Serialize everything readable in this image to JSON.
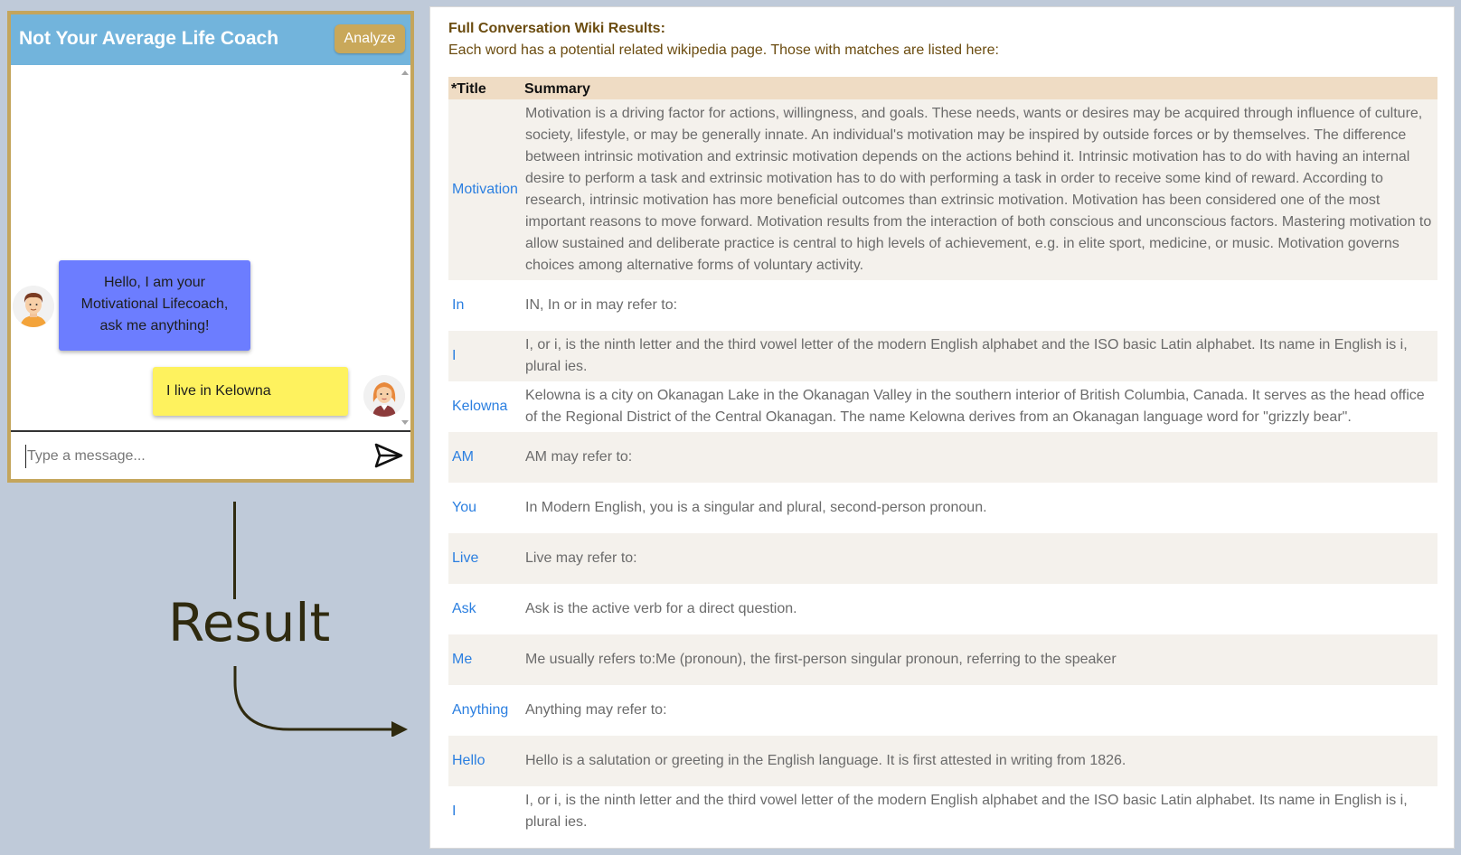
{
  "chat": {
    "title": "Not Your Average Life Coach",
    "analyze_label": "Analyze",
    "messages": [
      {
        "from": "bot",
        "text": "Hello, I am your Motivational Lifecoach, ask me anything!"
      },
      {
        "from": "user",
        "text": "I live in Kelowna"
      }
    ],
    "input_placeholder": "Type a message...",
    "input_value": ""
  },
  "annotation": {
    "label": "Result"
  },
  "wiki": {
    "heading": "Full Conversation Wiki Results:",
    "subheading": "Each word has a potential related wikipedia page. Those with matches are listed here:",
    "columns": {
      "title": "*Title",
      "summary": "Summary"
    },
    "rows": [
      {
        "title": "Motivation",
        "summary": "Motivation is a driving factor for actions, willingness, and goals. These needs, wants or desires may be acquired through influence of culture, society, lifestyle, or may be generally innate. An individual's motivation may be inspired by outside forces or by themselves. The difference between intrinsic motivation and extrinsic motivation depends on the actions behind it. Intrinsic motivation has to do with having an internal desire to perform a task and extrinsic motivation has to do with performing a task in order to receive some kind of reward. According to research, intrinsic motivation has more beneficial outcomes than extrinsic motivation. Motivation has been considered one of the most important reasons to move forward. Motivation results from the interaction of both conscious and unconscious factors. Mastering motivation to allow sustained and deliberate practice is central to high levels of achievement, e.g. in elite sport, medicine, or music. Motivation governs choices among alternative forms of voluntary activity."
      },
      {
        "title": "In",
        "summary": "IN, In or in may refer to:"
      },
      {
        "title": "I",
        "summary": "I, or i, is the ninth letter and the third vowel letter of the modern English alphabet and the ISO basic Latin alphabet. Its name in English is i, plural ies."
      },
      {
        "title": "Kelowna",
        "summary": "Kelowna is a city on Okanagan Lake in the Okanagan Valley in the southern interior of British Columbia, Canada. It serves as the head office of the Regional District of the Central Okanagan. The name Kelowna derives from an Okanagan language word for \"grizzly bear\"."
      },
      {
        "title": "AM",
        "summary": "AM may refer to:"
      },
      {
        "title": "You",
        "summary": "In Modern English, you is a singular and plural, second-person pronoun."
      },
      {
        "title": "Live",
        "summary": "Live may refer to:"
      },
      {
        "title": "Ask",
        "summary": "Ask is the active verb for a direct question."
      },
      {
        "title": "Me",
        "summary": "Me usually refers to:Me (pronoun), the first-person singular pronoun, referring to the speaker"
      },
      {
        "title": "Anything",
        "summary": "Anything may refer to:"
      },
      {
        "title": "Hello",
        "summary": "Hello is a salutation or greeting in the English language. It is first attested in writing from 1826."
      },
      {
        "title": "I",
        "summary": "I, or i, is the ninth letter and the third vowel letter of the modern English alphabet and the ISO basic Latin alphabet. Its name in English is i, plural ies."
      }
    ]
  },
  "icons": {
    "send": "send-icon",
    "bot_avatar": "male-avatar-icon",
    "user_avatar": "female-avatar-icon",
    "arrow": "curved-arrow-icon"
  },
  "colors": {
    "page_background": "#bfcad9",
    "chat_border": "#c4a55c",
    "chat_header": "#72b4dc",
    "analyze_button": "#c9a85a",
    "bot_bubble": "#6c7dff",
    "user_bubble": "#fef25e",
    "table_header": "#efdcc4",
    "table_alt_row": "#f4f1ec",
    "link_blue": "#2b7fe0",
    "heading_brown": "#6b4c10"
  }
}
